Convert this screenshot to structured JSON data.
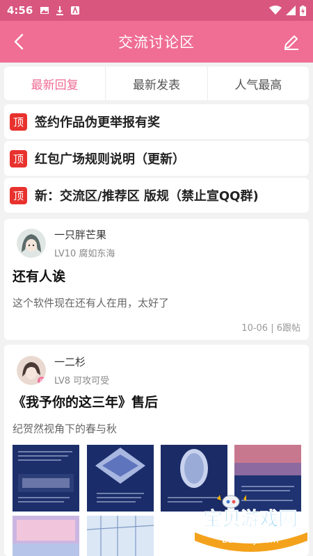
{
  "status_bar": {
    "time": "4:56"
  },
  "app_bar": {
    "title": "交流讨论区"
  },
  "tabs": [
    {
      "label": "最新回复",
      "active": true
    },
    {
      "label": "最新发表",
      "active": false
    },
    {
      "label": "人气最高",
      "active": false
    }
  ],
  "pinned": [
    {
      "tag": "顶",
      "title": "签约作品伪更举报有奖"
    },
    {
      "tag": "顶",
      "title": "红包广场规则说明（更新）"
    },
    {
      "tag": "顶",
      "title": "新：交流区/推荐区 版规（禁止宣QQ群)"
    }
  ],
  "posts": [
    {
      "username": "一只胖芒果",
      "level": "LV10 腐如东海",
      "title": "还有人诶",
      "summary": "这个软件现在还有人在用，太好了",
      "meta": "10-06 | 6跟帖"
    },
    {
      "username": "一二杉",
      "level": "LV8 可攻可受",
      "title": "《我予你的这三年》售后",
      "summary": "纪贺然视角下的春与秋"
    }
  ],
  "watermark": {
    "main": "宝贝游戏网",
    "url": "baobeiy.com"
  },
  "colors": {
    "status_bar": "#d9567f",
    "app_bar": "#f06d94",
    "accent": "#ef6b94",
    "pin_tag": "#e8322e"
  }
}
